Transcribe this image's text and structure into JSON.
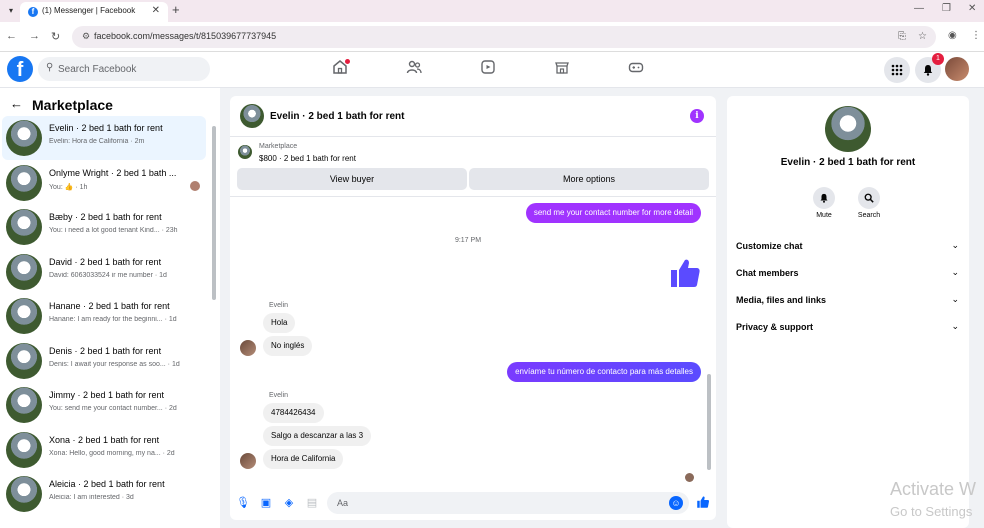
{
  "browser": {
    "tab_title": "(1) Messenger | Facebook",
    "url": "facebook.com/messages/t/815039677737945"
  },
  "header": {
    "search_placeholder": "Search Facebook",
    "notification_count": "1",
    "nav_icons": [
      "home-icon",
      "friends-icon",
      "video-icon",
      "marketplace-icon",
      "gaming-icon"
    ]
  },
  "sidebar": {
    "title": "Marketplace",
    "conversations": [
      {
        "name": "Evelin · 2 bed 1 bath for rent",
        "preview": "Evelin: Hora de California · 2m",
        "active": true
      },
      {
        "name": "Onlyme Wright · 2 bed 1 bath ...",
        "preview": "You: 👍 · 1h",
        "active": false
      },
      {
        "name": "Bæby · 2 bed 1 bath for rent",
        "preview": "You: i need a lot good tenant Kind... · 23h",
        "active": false
      },
      {
        "name": "David · 2 bed 1 bath for rent",
        "preview": "David: 6063033524 ir me number · 1d",
        "active": false
      },
      {
        "name": "Hanane · 2 bed 1 bath for rent",
        "preview": "Hanane: I am ready for the beginni... · 1d",
        "active": false
      },
      {
        "name": "Denis · 2 bed 1 bath for rent",
        "preview": "Denis: I await your response as soo... · 1d",
        "active": false
      },
      {
        "name": "Jimmy · 2 bed 1 bath for rent",
        "preview": "You: send me your contact number... · 2d",
        "active": false
      },
      {
        "name": "Xona · 2 bed 1 bath for rent",
        "preview": "Xona: Hello, good morning, my na... · 2d",
        "active": false
      },
      {
        "name": "Aleicia · 2 bed 1 bath for rent",
        "preview": "Aleicia: I am interested · 3d",
        "active": false
      }
    ]
  },
  "chat": {
    "title": "Evelin · 2 bed 1 bath for rent",
    "marketplace_label": "Marketplace",
    "listing": "$800 · 2 bed 1 bath for rent",
    "view_buyer_label": "View buyer",
    "more_options_label": "More options",
    "msg_out_1": "send me your contact number for more detail",
    "timestamp": "9:17 PM",
    "sender_1": "Evelin",
    "msg_in_1": "Hola",
    "msg_in_2": "No inglés",
    "msg_out_2": "envíame tu número de contacto para más detalles",
    "sender_2": "Evelin",
    "msg_in_3": "4784426434",
    "msg_in_4": "Salgo a descanzar a las 3",
    "msg_in_5": "Hora de California",
    "composer_placeholder": "Aa"
  },
  "details": {
    "title": "Evelin · 2 bed 1 bath for rent",
    "mute_label": "Mute",
    "search_label": "Search",
    "sections": [
      "Customize chat",
      "Chat members",
      "Media, files and links",
      "Privacy & support"
    ]
  },
  "watermark": {
    "line1": "Activate W",
    "line2": "Go to Settings"
  },
  "colors": {
    "fb_blue": "#1877f2",
    "outgoing_bubble": "#a033ff",
    "notification_red": "#e41e3f"
  }
}
